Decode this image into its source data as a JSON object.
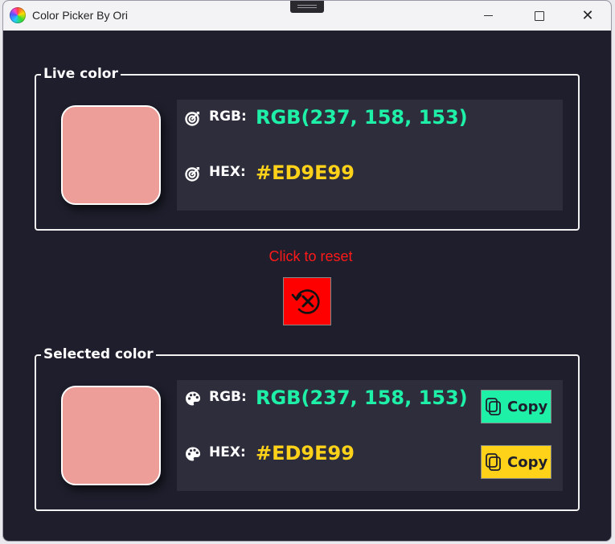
{
  "window": {
    "title": "Color Picker By Ori"
  },
  "colors": {
    "background": "#1e1e2c",
    "panel": "#2e2d3c",
    "rgb_accent": "#1ef0a8",
    "hex_accent": "#ffd21a",
    "reset_red": "#ff0000",
    "swatch": "#ED9E99"
  },
  "live": {
    "legend": "Live color",
    "rgb_label": "RGB:",
    "rgb_value": "RGB(237, 158, 153)",
    "hex_label": "HEX:",
    "hex_value": "#ED9E99",
    "icon": "target-icon"
  },
  "reset": {
    "label": "Click to reset",
    "icon": "reset-icon"
  },
  "selected": {
    "legend": "Selected color",
    "rgb_label": "RGB:",
    "rgb_value": "RGB(237, 158, 153)",
    "hex_label": "HEX:",
    "hex_value": "#ED9E99",
    "icon": "palette-icon",
    "copy_rgb_label": "Copy",
    "copy_hex_label": "Copy"
  }
}
